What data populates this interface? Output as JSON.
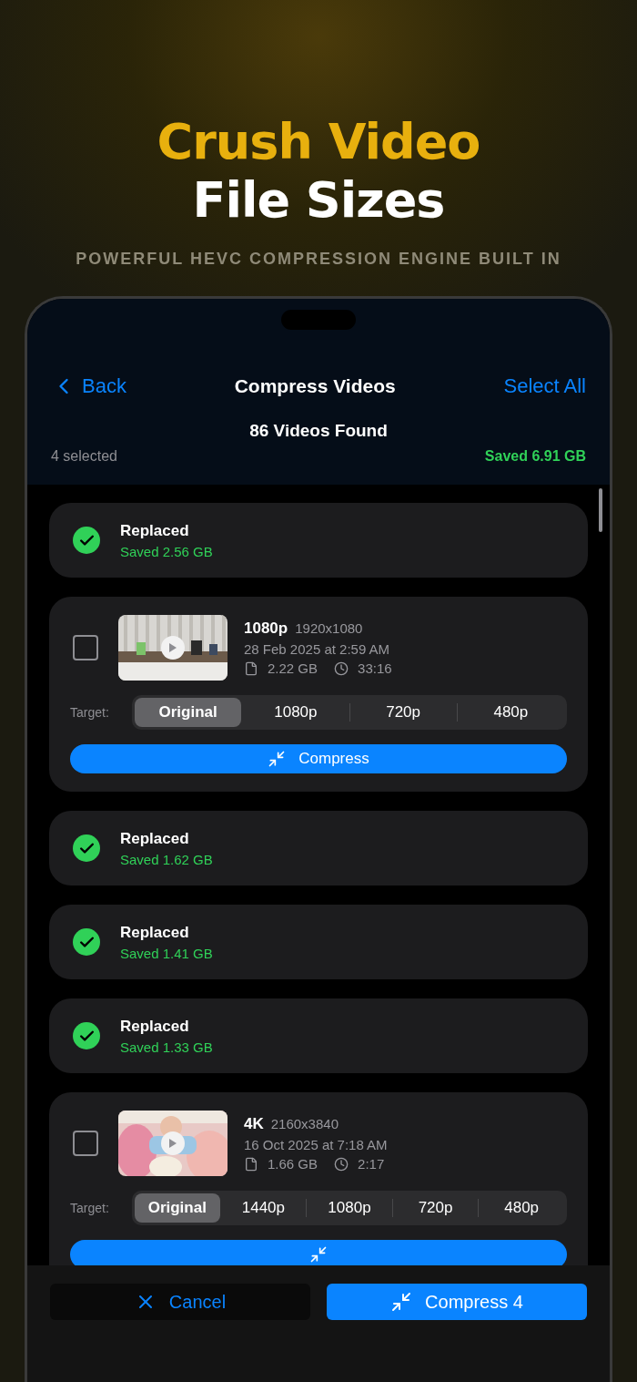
{
  "headline": {
    "line_1": "Crush Video",
    "line_2": "File Sizes"
  },
  "subtitle": "POWERFUL HEVC COMPRESSION ENGINE BUILT IN",
  "nav": {
    "back": "Back",
    "title": "Compress Videos",
    "action": "Select All"
  },
  "summary": {
    "count": "86 Videos Found",
    "selected": "4 selected",
    "saved": "Saved 6.91 GB"
  },
  "items": [
    {
      "kind": "replaced",
      "status": "Replaced",
      "saved": "Saved 2.56 GB"
    },
    {
      "kind": "video",
      "checked": false,
      "resolution": "1080p",
      "dimensions": "1920x1080",
      "date": "28 Feb 2025 at 2:59 AM",
      "size": "2.22 GB",
      "duration": "33:16",
      "target_label": "Target:",
      "targets": [
        {
          "label": "Original",
          "selected": true
        },
        {
          "label": "1080p",
          "selected": false
        },
        {
          "label": "720p",
          "selected": false
        },
        {
          "label": "480p",
          "selected": false
        }
      ],
      "compress_button": "Compress"
    },
    {
      "kind": "replaced",
      "status": "Replaced",
      "saved": "Saved 1.62 GB"
    },
    {
      "kind": "replaced",
      "status": "Replaced",
      "saved": "Saved 1.41 GB"
    },
    {
      "kind": "replaced",
      "status": "Replaced",
      "saved": "Saved 1.33 GB"
    },
    {
      "kind": "video",
      "checked": false,
      "resolution": "4K",
      "dimensions": "2160x3840",
      "date": "16 Oct 2025 at 7:18 AM",
      "size": "1.66 GB",
      "duration": "2:17",
      "target_label": "Target:",
      "targets": [
        {
          "label": "Original",
          "selected": true
        },
        {
          "label": "1440p",
          "selected": false
        },
        {
          "label": "1080p",
          "selected": false
        },
        {
          "label": "720p",
          "selected": false
        },
        {
          "label": "480p",
          "selected": false
        }
      ]
    }
  ],
  "bottom_bar": {
    "cancel": "Cancel",
    "compress": "Compress 4"
  }
}
